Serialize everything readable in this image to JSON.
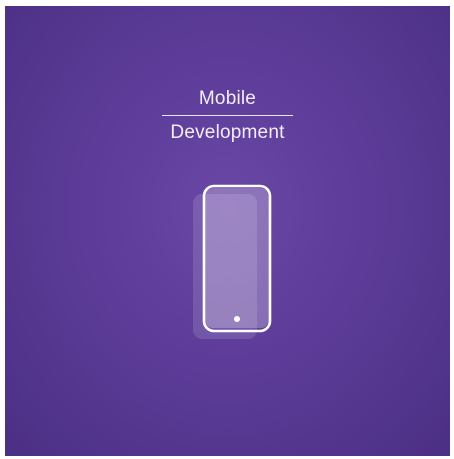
{
  "card": {
    "title_line_1": "Mobile",
    "title_line_2": "Development",
    "icon": "smartphone-icon",
    "colors": {
      "background_center": "#6a47a6",
      "background_edge": "#4b2f84",
      "foreground": "#ffffff"
    }
  }
}
